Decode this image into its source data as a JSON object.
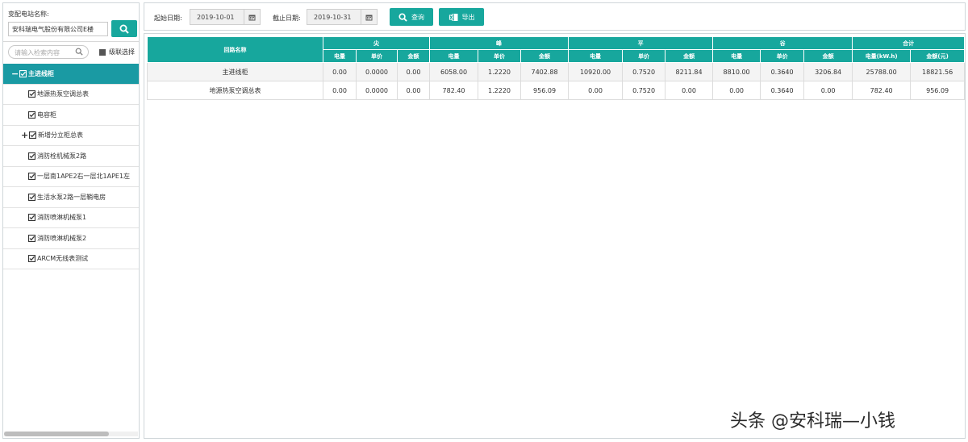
{
  "sidebar": {
    "station_label": "变配电站名称:",
    "station_value": "安科瑞电气股份有限公司E楼",
    "search_placeholder": "请输入检索内容",
    "cascade_label": "级联选择",
    "root_label": "主进线柜",
    "items": [
      {
        "label": "地源热泵空调总表"
      },
      {
        "label": "电容柜"
      },
      {
        "label": "新增分立柜总表"
      },
      {
        "label": "消防栓机械泵2路"
      },
      {
        "label": "一层南1APE2右一层北1APE1左"
      },
      {
        "label": "生活水泵2路一层鞘电房"
      },
      {
        "label": "消防喷淋机械泵1"
      },
      {
        "label": "消防喷淋机械泵2"
      },
      {
        "label": "ARCM无线表测试"
      }
    ]
  },
  "toolbar": {
    "start_label": "起始日期:",
    "start_value": "2019-10-01",
    "end_label": "截止日期:",
    "end_value": "2019-10-31",
    "query_label": "查询",
    "export_label": "导出"
  },
  "table": {
    "col_name": "回路名称",
    "groups": [
      "尖",
      "峰",
      "平",
      "谷",
      "合计"
    ],
    "sub_energy": "电量",
    "sub_price": "单价",
    "sub_amount": "金额",
    "total_energy": "电量(kW.h)",
    "total_amount": "金额(元)",
    "rows": [
      {
        "cells": [
          "主进线柜",
          "0.00",
          "0.0000",
          "0.00",
          "6058.00",
          "1.2220",
          "7402.88",
          "10920.00",
          "0.7520",
          "8211.84",
          "8810.00",
          "0.3640",
          "3206.84",
          "25788.00",
          "18821.56"
        ]
      },
      {
        "cells": [
          "地源热泵空调总表",
          "0.00",
          "0.0000",
          "0.00",
          "782.40",
          "1.2220",
          "956.09",
          "0.00",
          "0.7520",
          "0.00",
          "0.00",
          "0.3640",
          "0.00",
          "782.40",
          "956.09"
        ]
      }
    ]
  },
  "watermark": "头条 @安科瑞—小钱",
  "colors": {
    "accent": "#17a79d",
    "tree_selected": "#1a9aa3"
  }
}
